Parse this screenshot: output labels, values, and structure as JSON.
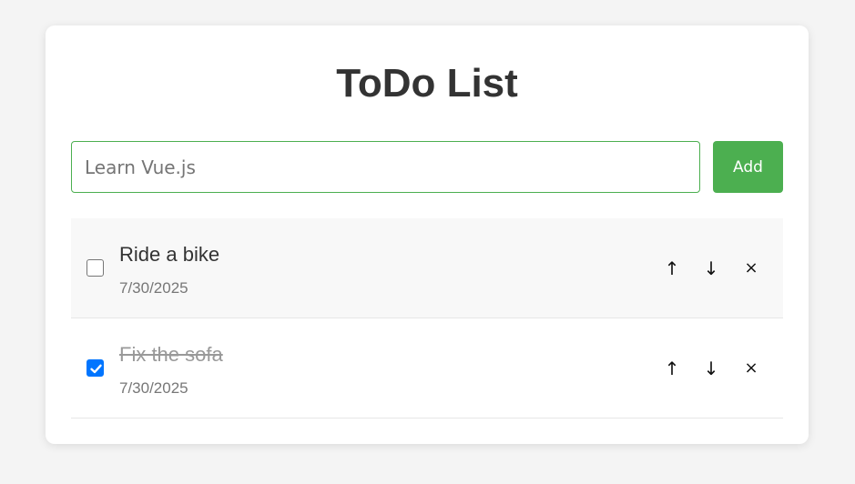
{
  "title": "ToDo List",
  "new_todo": {
    "value": "",
    "placeholder": "Learn Vue.js",
    "add_label": "Add"
  },
  "todos": [
    {
      "text": "Ride a bike",
      "date": "7/30/2025",
      "done": false,
      "up": "↑",
      "down": "↓",
      "remove": "×"
    },
    {
      "text": "Fix the sofa",
      "date": "7/30/2025",
      "done": true,
      "up": "↑",
      "down": "↓",
      "remove": "×"
    }
  ],
  "colors": {
    "accent": "#4caf50",
    "checkbox_checked": "#0075ff"
  }
}
